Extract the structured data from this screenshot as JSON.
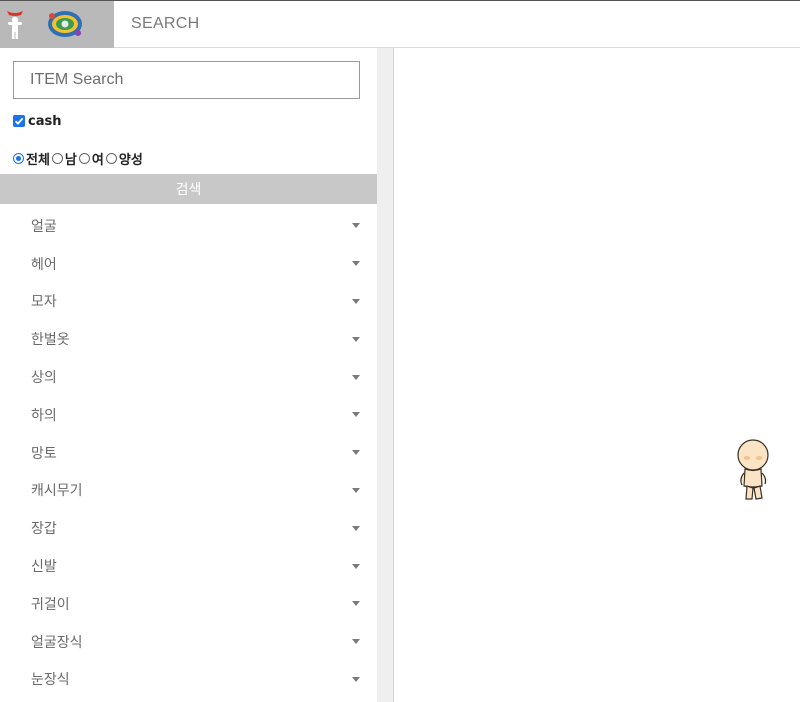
{
  "header": {
    "title": "SEARCH",
    "logo_icon": "mascot-figure-icon",
    "game_icon": "game-emblem-icon"
  },
  "sidebar": {
    "search_placeholder": "ITEM Search",
    "search_value": "",
    "cash_label": "cash",
    "cash_checked": true,
    "gender_options": [
      "전체",
      "남",
      "여",
      "양성"
    ],
    "gender_selected": "전체",
    "search_button": "검색",
    "categories": [
      "얼굴",
      "헤어",
      "모자",
      "한벌옷",
      "상의",
      "하의",
      "망토",
      "캐시무기",
      "장갑",
      "신발",
      "귀걸이",
      "얼굴장식",
      "눈장식"
    ]
  },
  "colors": {
    "accent": "#1a73e8",
    "logo_bg": "#b9b9b9",
    "button_bg": "#c8c8c8"
  }
}
